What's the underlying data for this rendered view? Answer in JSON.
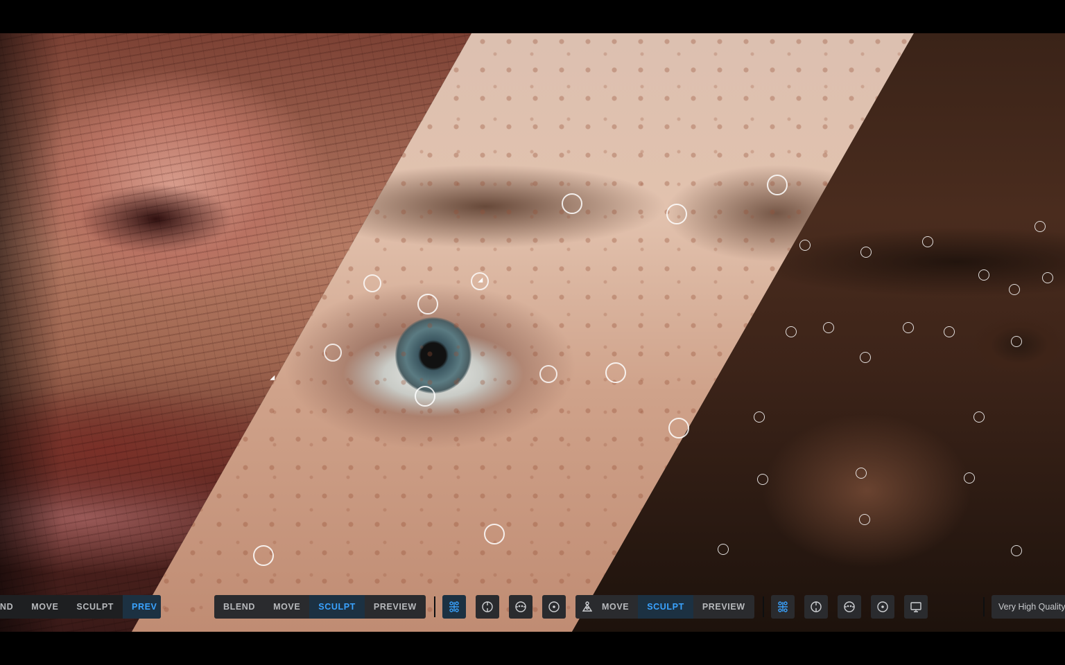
{
  "left_toolbar": {
    "blend": "END",
    "move": "MOVE",
    "sculpt": "SCULPT",
    "preview": "PREV"
  },
  "middle_toolbar": {
    "blend": "BLEND",
    "move": "MOVE",
    "sculpt": "SCULPT",
    "preview": "PREVIEW",
    "active_mode": "SCULPT",
    "tools": [
      "landmarks-icon",
      "center-crosshair-icon",
      "face-icon",
      "target-dot-icon",
      "rig-icon"
    ]
  },
  "right_toolbar": {
    "move": "MOVE",
    "sculpt": "SCULPT",
    "preview": "PREVIEW",
    "active_mode": "SCULPT",
    "tools": [
      "landmarks-icon",
      "center-crosshair-icon",
      "face-icon",
      "target-dot-icon",
      "monitor-icon"
    ],
    "quality": "Very High Quality"
  },
  "colors": {
    "accent": "#3aa3ff",
    "toolbar_bg": "#2a2b2e",
    "active_bg": "#1c3142",
    "text": "#b8babd"
  }
}
